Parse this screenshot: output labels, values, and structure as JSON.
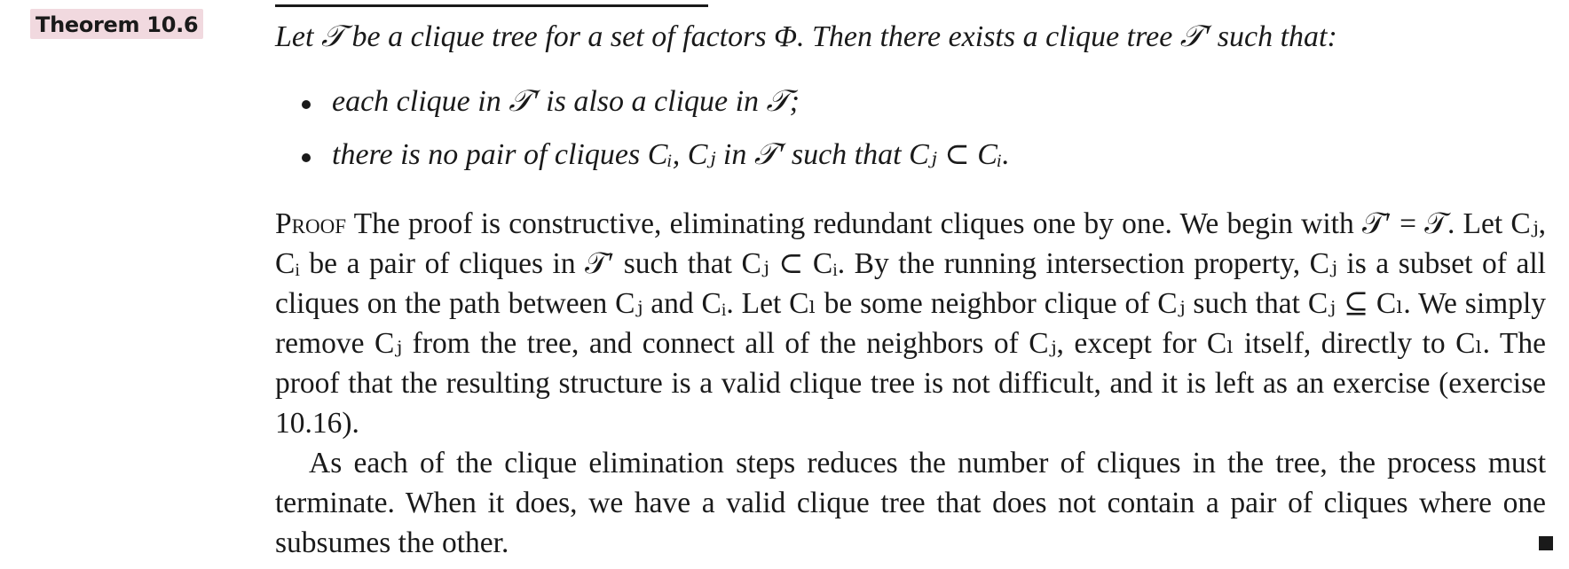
{
  "theorem": {
    "label": "Theorem 10.6",
    "statement": "Let 𝒯 be a clique tree for a set of factors Φ. Then there exists a clique tree 𝒯′ such that:",
    "bullets": [
      "each clique in 𝒯′ is also a clique in 𝒯;",
      "there is no pair of cliques Cᵢ, Cⱼ in 𝒯′ such that Cⱼ ⊂ Cᵢ."
    ]
  },
  "proof": {
    "heading": "Proof",
    "paragraph1": "The proof is constructive, eliminating redundant cliques one by one. We begin with 𝒯′ = 𝒯. Let Cⱼ, Cᵢ be a pair of cliques in 𝒯′ such that Cⱼ ⊂ Cᵢ. By the running intersection property, Cⱼ is a subset of all cliques on the path between Cⱼ and Cᵢ. Let Cₗ be some neighbor clique of Cⱼ such that Cⱼ ⊆ Cₗ. We simply remove Cⱼ from the tree, and connect all of the neighbors of Cⱼ, except for Cₗ itself, directly to Cₗ. The proof that the resulting structure is a valid clique tree is not difficult, and it is left as an exercise (exercise 10.16).",
    "paragraph2": "As each of the clique elimination steps reduces the number of cliques in the tree, the process must terminate. When it does, we have a valid clique tree that does not contain a pair of cliques where one subsumes the other."
  }
}
